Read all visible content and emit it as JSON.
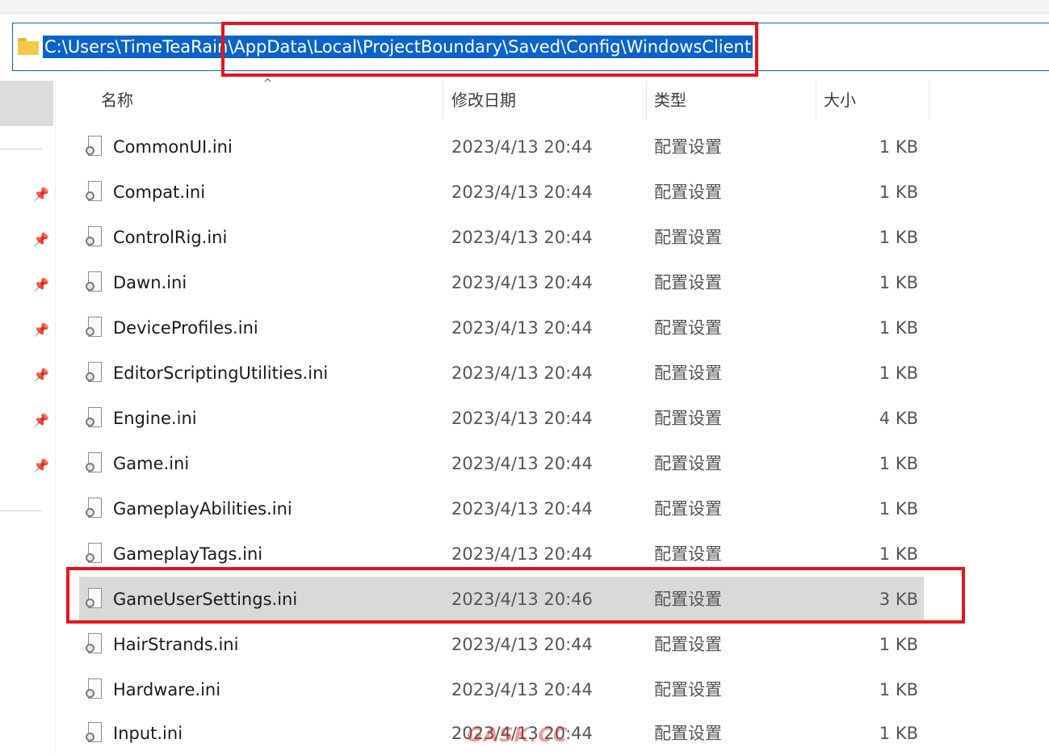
{
  "address": {
    "path": "C:\\Users\\TimeTeaRain\\AppData\\Local\\ProjectBoundary\\Saved\\Config\\WindowsClient",
    "icon": "folder-icon"
  },
  "columns": {
    "name": "名称",
    "date": "修改日期",
    "type": "类型",
    "size": "大小"
  },
  "files": [
    {
      "name": "CommonUI.ini",
      "date": "2023/4/13 20:44",
      "type": "配置设置",
      "size": "1 KB"
    },
    {
      "name": "Compat.ini",
      "date": "2023/4/13 20:44",
      "type": "配置设置",
      "size": "1 KB"
    },
    {
      "name": "ControlRig.ini",
      "date": "2023/4/13 20:44",
      "type": "配置设置",
      "size": "1 KB"
    },
    {
      "name": "Dawn.ini",
      "date": "2023/4/13 20:44",
      "type": "配置设置",
      "size": "1 KB"
    },
    {
      "name": "DeviceProfiles.ini",
      "date": "2023/4/13 20:44",
      "type": "配置设置",
      "size": "1 KB"
    },
    {
      "name": "EditorScriptingUtilities.ini",
      "date": "2023/4/13 20:44",
      "type": "配置设置",
      "size": "1 KB"
    },
    {
      "name": "Engine.ini",
      "date": "2023/4/13 20:44",
      "type": "配置设置",
      "size": "4 KB"
    },
    {
      "name": "Game.ini",
      "date": "2023/4/13 20:44",
      "type": "配置设置",
      "size": "1 KB"
    },
    {
      "name": "GameplayAbilities.ini",
      "date": "2023/4/13 20:44",
      "type": "配置设置",
      "size": "1 KB"
    },
    {
      "name": "GameplayTags.ini",
      "date": "2023/4/13 20:44",
      "type": "配置设置",
      "size": "1 KB"
    },
    {
      "name": "GameUserSettings.ini",
      "date": "2023/4/13 20:46",
      "type": "配置设置",
      "size": "3 KB",
      "selected": true
    },
    {
      "name": "HairStrands.ini",
      "date": "2023/4/13 20:44",
      "type": "配置设置",
      "size": "1 KB"
    },
    {
      "name": "Hardware.ini",
      "date": "2023/4/13 20:44",
      "type": "配置设置",
      "size": "1 KB"
    },
    {
      "name": "Input.ini",
      "date": "2023/4/13 20:44",
      "type": "配置设置",
      "size": "1 KB"
    }
  ],
  "nav": {
    "pin_icon": "pin-icon",
    "pin_count": 7
  },
  "watermark": "GASK.CC",
  "colors": {
    "highlight": "#e8141b",
    "selection": "#0a63c9",
    "selected_row": "#d9d9d9"
  }
}
